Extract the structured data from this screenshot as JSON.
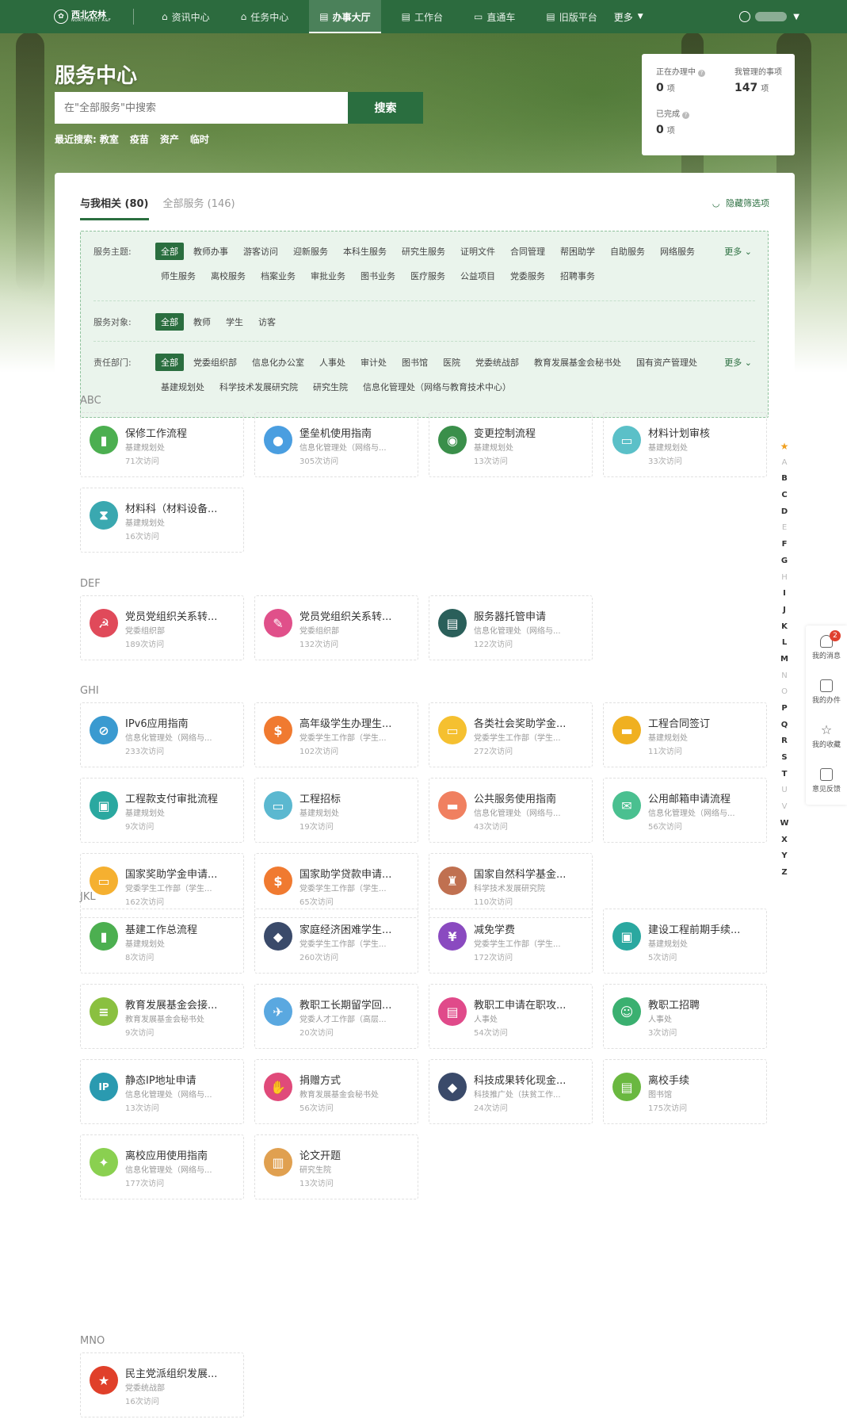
{
  "nav": {
    "logo_cn": "西北农林",
    "logo_en": "NORTHWEST A&F",
    "items": [
      {
        "label": "资讯中心",
        "icon": "bank-icon"
      },
      {
        "label": "任务中心",
        "icon": "bank-icon"
      },
      {
        "label": "办事大厅",
        "icon": "document-icon",
        "active": true
      },
      {
        "label": "工作台",
        "icon": "document-icon"
      },
      {
        "label": "直通车",
        "icon": "monitor-icon"
      },
      {
        "label": "旧版平台",
        "icon": "document-icon"
      }
    ],
    "more_label": "更多"
  },
  "hero": {
    "title": "服务中心",
    "search_placeholder": "在\"全部服务\"中搜索",
    "search_button": "搜索",
    "recent_label": "最近搜索:",
    "recent_terms": [
      "教室",
      "疫苗",
      "资产",
      "临时"
    ]
  },
  "stats": {
    "in_progress_label": "正在办理中",
    "in_progress_value": "0",
    "managed_label": "我管理的事项",
    "managed_value": "147",
    "completed_label": "已完成",
    "completed_value": "0",
    "unit": "项"
  },
  "tabs": [
    {
      "label": "与我相关 (80)",
      "active": true
    },
    {
      "label": "全部服务 (146)",
      "active": false
    }
  ],
  "hide_filter_label": "隐藏筛选项",
  "filters": {
    "topic_label": "服务主题:",
    "topics": [
      "全部",
      "教师办事",
      "游客访问",
      "迎新服务",
      "本科生服务",
      "研究生服务",
      "证明文件",
      "合同管理",
      "帮困助学",
      "自助服务",
      "网络服务",
      "师生服务",
      "离校服务",
      "档案业务",
      "审批业务",
      "图书业务",
      "医疗服务",
      "公益项目",
      "党委服务",
      "招聘事务"
    ],
    "target_label": "服务对象:",
    "targets": [
      "全部",
      "教师",
      "学生",
      "访客"
    ],
    "dept_label": "责任部门:",
    "depts": [
      "全部",
      "党委组织部",
      "信息化办公室",
      "人事处",
      "审计处",
      "图书馆",
      "医院",
      "党委统战部",
      "教育发展基金会秘书处",
      "国有资产管理处",
      "基建规划处",
      "科学技术发展研究院",
      "研究生院",
      "信息化管理处（网络与教育技术中心）"
    ],
    "more_label": "更多"
  },
  "sections": [
    {
      "title": "ABC",
      "items": [
        {
          "title": "保修工作流程",
          "dept": "基建规划处",
          "visits": "71次访问",
          "color": "#4caf50",
          "glyph": "▮"
        },
        {
          "title": "堡垒机使用指南",
          "dept": "信息化管理处（网络与...",
          "visits": "305次访问",
          "color": "#4a9ee0",
          "glyph": "●"
        },
        {
          "title": "变更控制流程",
          "dept": "基建规划处",
          "visits": "13次访问",
          "color": "#3a8f4a",
          "glyph": "◉"
        },
        {
          "title": "材料计划审核",
          "dept": "基建规划处",
          "visits": "33次访问",
          "color": "#5bc0c8",
          "glyph": "▭"
        },
        {
          "title": "材料科（材料设备...",
          "dept": "基建规划处",
          "visits": "16次访问",
          "color": "#3aa8b0",
          "glyph": "⧗"
        }
      ]
    },
    {
      "title": "DEF",
      "items": [
        {
          "title": "党员党组织关系转...",
          "dept": "党委组织部",
          "visits": "189次访问",
          "color": "#e04a5a",
          "glyph": "☭"
        },
        {
          "title": "党员党组织关系转...",
          "dept": "党委组织部",
          "visits": "132次访问",
          "color": "#e0508a",
          "glyph": "✎"
        },
        {
          "title": "服务器托管申请",
          "dept": "信息化管理处（网络与...",
          "visits": "122次访问",
          "color": "#2a5f5a",
          "glyph": "▤"
        }
      ]
    },
    {
      "title": "GHI",
      "items": [
        {
          "title": "IPv6应用指南",
          "dept": "信息化管理处（网络与...",
          "visits": "233次访问",
          "color": "#3a9ad0",
          "glyph": "⊘"
        },
        {
          "title": "高年级学生办理生...",
          "dept": "党委学生工作部（学生...",
          "visits": "102次访问",
          "color": "#f07a30",
          "glyph": "$"
        },
        {
          "title": "各类社会奖助学金...",
          "dept": "党委学生工作部（学生...",
          "visits": "272次访问",
          "color": "#f5c030",
          "glyph": "▭"
        },
        {
          "title": "工程合同签订",
          "dept": "基建规划处",
          "visits": "11次访问",
          "color": "#f0b020",
          "glyph": "▬"
        },
        {
          "title": "工程款支付审批流程",
          "dept": "基建规划处",
          "visits": "9次访问",
          "color": "#2aa8a0",
          "glyph": "▣"
        },
        {
          "title": "工程招标",
          "dept": "基建规划处",
          "visits": "19次访问",
          "color": "#5bb8d0",
          "glyph": "▭"
        },
        {
          "title": "公共服务使用指南",
          "dept": "信息化管理处（网络与...",
          "visits": "43次访问",
          "color": "#f08060",
          "glyph": "▬"
        },
        {
          "title": "公用邮箱申请流程",
          "dept": "信息化管理处（网络与...",
          "visits": "56次访问",
          "color": "#4ac090",
          "glyph": "✉"
        },
        {
          "title": "国家奖助学金申请...",
          "dept": "党委学生工作部（学生...",
          "visits": "162次访问",
          "color": "#f5b030",
          "glyph": "▭"
        },
        {
          "title": "国家助学贷款申请...",
          "dept": "党委学生工作部（学生...",
          "visits": "65次访问",
          "color": "#f07a30",
          "glyph": "$"
        },
        {
          "title": "国家自然科学基金...",
          "dept": "科学技术发展研究院",
          "visits": "110次访问",
          "color": "#c07050",
          "glyph": "♜"
        }
      ]
    },
    {
      "title": "JKL",
      "items": [
        {
          "title": "基建工作总流程",
          "dept": "基建规划处",
          "visits": "8次访问",
          "color": "#4caf50",
          "glyph": "▮"
        },
        {
          "title": "家庭经济困难学生...",
          "dept": "党委学生工作部（学生...",
          "visits": "260次访问",
          "color": "#3a4a6a",
          "glyph": "◆"
        },
        {
          "title": "减免学费",
          "dept": "党委学生工作部（学生...",
          "visits": "172次访问",
          "color": "#8a4ac0",
          "glyph": "¥"
        },
        {
          "title": "建设工程前期手续...",
          "dept": "基建规划处",
          "visits": "5次访问",
          "color": "#2aa8a0",
          "glyph": "▣"
        },
        {
          "title": "教育发展基金会接...",
          "dept": "教育发展基金会秘书处",
          "visits": "9次访问",
          "color": "#8ac040",
          "glyph": "≡"
        },
        {
          "title": "教职工长期留学回...",
          "dept": "党委人才工作部（高层...",
          "visits": "20次访问",
          "color": "#5aa8e0",
          "glyph": "✈"
        },
        {
          "title": "教职工申请在职攻...",
          "dept": "人事处",
          "visits": "54次访问",
          "color": "#e04a8a",
          "glyph": "▤"
        },
        {
          "title": "教职工招聘",
          "dept": "人事处",
          "visits": "3次访问",
          "color": "#3ab070",
          "glyph": "☺"
        },
        {
          "title": "静态IP地址申请",
          "dept": "信息化管理处（网络与...",
          "visits": "13次访问",
          "color": "#2a9ab0",
          "glyph": "IP"
        },
        {
          "title": "捐赠方式",
          "dept": "教育发展基金会秘书处",
          "visits": "56次访问",
          "color": "#e04a7a",
          "glyph": "✋"
        },
        {
          "title": "科技成果转化现金...",
          "dept": "科技推广处（扶贫工作...",
          "visits": "24次访问",
          "color": "#3a4a6a",
          "glyph": "◆"
        },
        {
          "title": "离校手续",
          "dept": "图书馆",
          "visits": "175次访问",
          "color": "#6ab840",
          "glyph": "▤"
        },
        {
          "title": "离校应用使用指南",
          "dept": "信息化管理处（网络与...",
          "visits": "177次访问",
          "color": "#8ad050",
          "glyph": "✦"
        },
        {
          "title": "论文开题",
          "dept": "研究生院",
          "visits": "13次访问",
          "color": "#e0a050",
          "glyph": "▥"
        }
      ]
    },
    {
      "title": "MNO",
      "items": [
        {
          "title": "民主党派组织发展...",
          "dept": "党委统战部",
          "visits": "16次访问",
          "color": "#e0402a",
          "glyph": "★"
        }
      ]
    }
  ],
  "alphabet": [
    {
      "l": "A",
      "on": false
    },
    {
      "l": "B",
      "on": true
    },
    {
      "l": "C",
      "on": true
    },
    {
      "l": "D",
      "on": true
    },
    {
      "l": "E",
      "on": false
    },
    {
      "l": "F",
      "on": true
    },
    {
      "l": "G",
      "on": true
    },
    {
      "l": "H",
      "on": false
    },
    {
      "l": "I",
      "on": true
    },
    {
      "l": "J",
      "on": true
    },
    {
      "l": "K",
      "on": true
    },
    {
      "l": "L",
      "on": true
    },
    {
      "l": "M",
      "on": true
    },
    {
      "l": "N",
      "on": false
    },
    {
      "l": "O",
      "on": false
    },
    {
      "l": "P",
      "on": true
    },
    {
      "l": "Q",
      "on": true
    },
    {
      "l": "R",
      "on": true
    },
    {
      "l": "S",
      "on": true
    },
    {
      "l": "T",
      "on": true
    },
    {
      "l": "U",
      "on": false
    },
    {
      "l": "V",
      "on": false
    },
    {
      "l": "W",
      "on": true
    },
    {
      "l": "X",
      "on": true
    },
    {
      "l": "Y",
      "on": true
    },
    {
      "l": "Z",
      "on": true
    }
  ],
  "side": {
    "messages": "我的消息",
    "message_count": "2",
    "tasks": "我的办件",
    "favorites": "我的收藏",
    "feedback": "意见反馈"
  }
}
